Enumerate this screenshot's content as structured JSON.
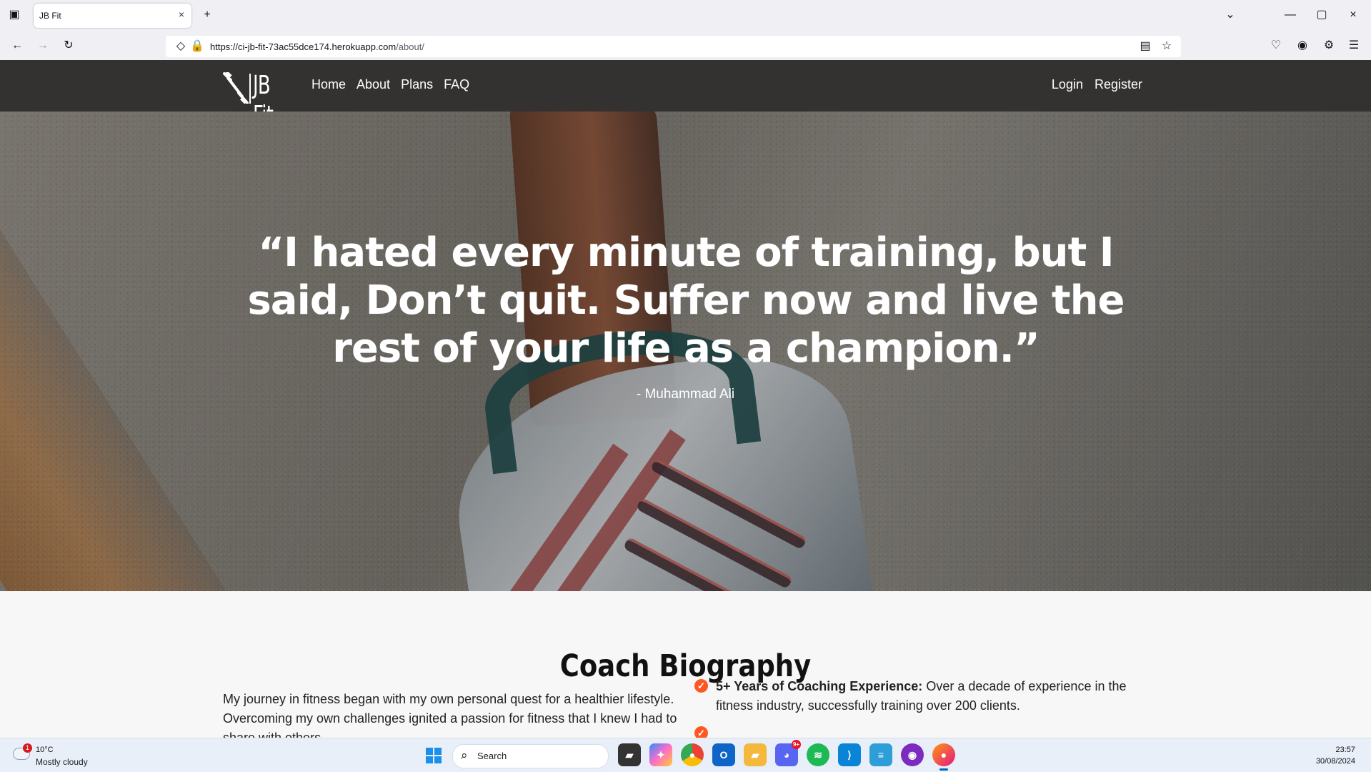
{
  "browser": {
    "tab_title": "JB Fit",
    "tab_close": "×",
    "new_tab": "+",
    "url_host": "https://ci-jb-fit-73ac55dce174.herokuapp.com",
    "url_path": "/about/",
    "icons": [
      "tab-list-icon",
      "back-icon",
      "forward-icon",
      "reload-icon",
      "tracking-shield-icon",
      "lock-icon",
      "reader-view-icon",
      "bookmark-star-icon",
      "pocket-icon",
      "account-icon",
      "extensions-icon",
      "menu-icon",
      "minimize-icon",
      "restore-icon",
      "close-window-icon",
      "list-all-tabs-icon"
    ]
  },
  "site": {
    "logo_text": "JB Fit",
    "nav": [
      "Home",
      "About",
      "Plans",
      "FAQ"
    ],
    "auth": [
      "Login",
      "Register"
    ]
  },
  "hero": {
    "quote": "“I hated every minute of training, but I said, Don’t quit. Suffer now and live the rest of your life as a champion.”",
    "author": "- Muhammad Ali"
  },
  "bio": {
    "title": "Coach Biography",
    "left_text": "My journey in fitness began with my own personal quest for a healthier lifestyle. Overcoming my own challenges ignited a passion for fitness that I knew I had to share with others.",
    "items": [
      {
        "title": "5+ Years of Coaching Experience:",
        "text": "Over a decade of experience in the fitness industry, successfully training over 200 clients."
      }
    ]
  },
  "taskbar": {
    "weather_badge": "1",
    "temperature": "10°C",
    "condition": "Mostly cloudy",
    "search_label": "Search",
    "time": "23:57",
    "date": "30/08/2024",
    "apps": [
      "Explorer",
      "Copilot",
      "Chrome",
      "Outlook",
      "Files",
      "Discord",
      "Spotify",
      "VS Code",
      "Notepad",
      "GitHub",
      "Firefox"
    ],
    "discord_badge": "9+"
  },
  "colors": {
    "navbar": "#333230",
    "accent": "#ff5722",
    "taskbar": "#e8eff8",
    "hero_shade": "#191919"
  }
}
